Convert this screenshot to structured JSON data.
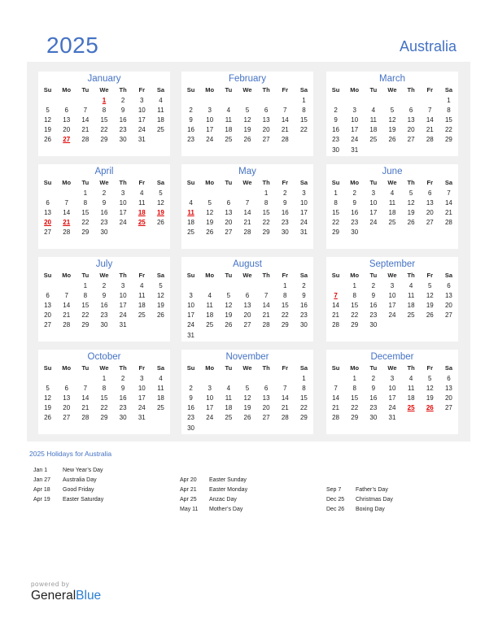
{
  "header": {
    "year": "2025",
    "country": "Australia"
  },
  "weekdays": [
    "Su",
    "Mo",
    "Tu",
    "We",
    "Th",
    "Fr",
    "Sa"
  ],
  "months": [
    {
      "name": "January",
      "start": 3,
      "days": 31,
      "holidays": [
        1,
        27
      ]
    },
    {
      "name": "February",
      "start": 6,
      "days": 28,
      "holidays": []
    },
    {
      "name": "March",
      "start": 6,
      "days": 31,
      "holidays": []
    },
    {
      "name": "April",
      "start": 2,
      "days": 30,
      "holidays": [
        18,
        19,
        20,
        21,
        25
      ]
    },
    {
      "name": "May",
      "start": 4,
      "days": 31,
      "holidays": [
        11
      ]
    },
    {
      "name": "June",
      "start": 0,
      "days": 30,
      "holidays": []
    },
    {
      "name": "July",
      "start": 2,
      "days": 31,
      "holidays": []
    },
    {
      "name": "August",
      "start": 5,
      "days": 31,
      "holidays": []
    },
    {
      "name": "September",
      "start": 1,
      "days": 30,
      "holidays": [
        7
      ]
    },
    {
      "name": "October",
      "start": 3,
      "days": 31,
      "holidays": []
    },
    {
      "name": "November",
      "start": 6,
      "days": 30,
      "holidays": []
    },
    {
      "name": "December",
      "start": 1,
      "days": 31,
      "holidays": [
        25,
        26
      ]
    }
  ],
  "holidays_title": "2025 Holidays for Australia",
  "holiday_columns": [
    [
      {
        "date": "Jan 1",
        "name": "New Year’s Day"
      },
      {
        "date": "Jan 27",
        "name": "Australia Day"
      },
      {
        "date": "Apr 18",
        "name": "Good Friday"
      },
      {
        "date": "Apr 19",
        "name": "Easter Saturday"
      }
    ],
    [
      {
        "date": "Apr 20",
        "name": "Easter Sunday"
      },
      {
        "date": "Apr 21",
        "name": "Easter Monday"
      },
      {
        "date": "Apr 25",
        "name": "Anzac Day"
      },
      {
        "date": "May 11",
        "name": "Mother’s Day"
      }
    ],
    [
      {
        "date": "Sep 7",
        "name": "Father’s Day"
      },
      {
        "date": "Dec 25",
        "name": "Christmas Day"
      },
      {
        "date": "Dec 26",
        "name": "Boxing Day"
      }
    ]
  ],
  "branding": {
    "powered_by": "powered by",
    "general": "General",
    "blue": "Blue"
  },
  "colors": {
    "accent": "#4472c4",
    "holiday": "#e00000",
    "panel": "#f0f0f0"
  }
}
